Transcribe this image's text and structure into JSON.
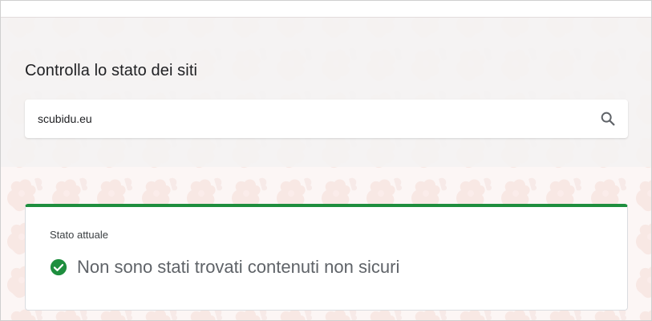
{
  "header": {
    "title": "Controlla lo stato dei siti"
  },
  "search": {
    "value": "scubidu.eu",
    "icon": "search-icon"
  },
  "status": {
    "label": "Stato attuale",
    "message": "Non sono stati trovati contenuti non sicuri",
    "icon": "check-circle-icon",
    "color": "#1e8e3e"
  }
}
